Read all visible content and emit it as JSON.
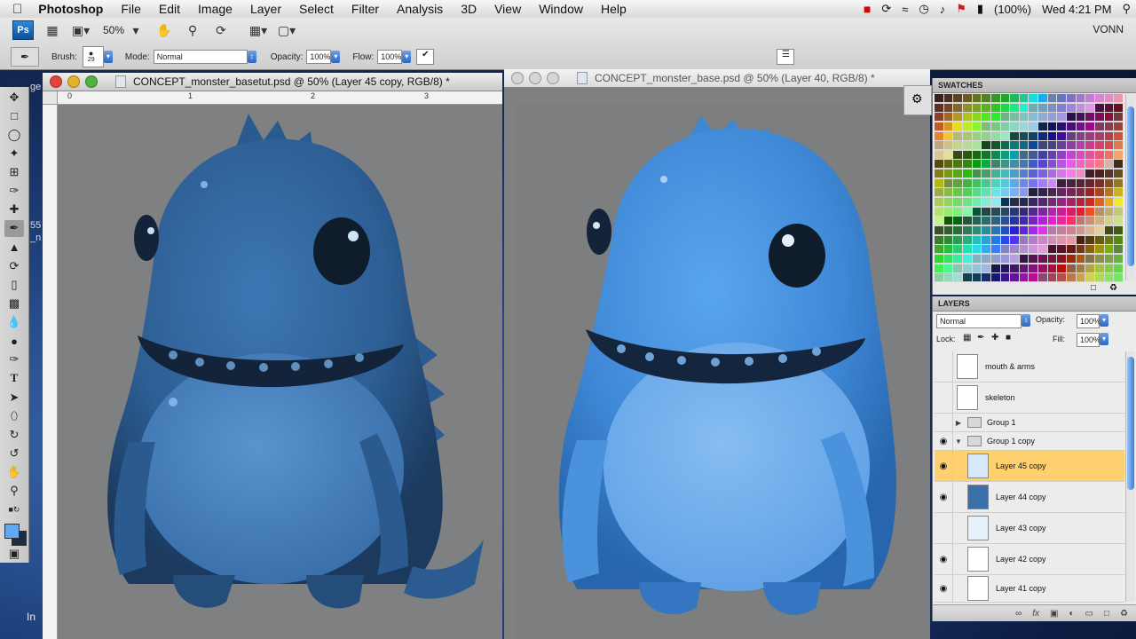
{
  "menubar": {
    "app_name": "Photoshop",
    "items": [
      "File",
      "Edit",
      "Image",
      "Layer",
      "Select",
      "Filter",
      "Analysis",
      "3D",
      "View",
      "Window",
      "Help"
    ],
    "battery": "(100%)",
    "clock": "Wed 4:21 PM"
  },
  "appbar": {
    "logo": "Ps",
    "zoom": "50%",
    "user": "VONN"
  },
  "tool_options": {
    "brush_label": "Brush:",
    "brush_size": "29",
    "mode_label": "Mode:",
    "mode_value": "Normal",
    "opacity_label": "Opacity:",
    "opacity_value": "100%",
    "flow_label": "Flow:",
    "flow_value": "100%"
  },
  "doc_left": {
    "title": "CONCEPT_monster_basetut.psd @ 50% (Layer 45 copy, RGB/8) *",
    "ruler_labels": [
      "0",
      "1",
      "2",
      "3"
    ]
  },
  "doc_right": {
    "title": "CONCEPT_monster_base.psd @ 50% (Layer 40, RGB/8) *"
  },
  "desktop_text": {
    "partial1": "ge",
    "partial2": "55",
    "partial3": "_n",
    "partial4": "In"
  },
  "swatches": {
    "title": "SWATCHES"
  },
  "layers": {
    "title": "LAYERS",
    "blend_mode": "Normal",
    "opacity_label": "Opacity:",
    "opacity_value": "100%",
    "lock_label": "Lock:",
    "fill_label": "Fill:",
    "fill_value": "100%",
    "rows": [
      {
        "name": "mouth & arms",
        "visible": false,
        "kind": "layer"
      },
      {
        "name": "skeleton",
        "visible": false,
        "kind": "layer"
      },
      {
        "name": "Group 1",
        "visible": false,
        "kind": "group",
        "expanded": false
      },
      {
        "name": "Group 1 copy",
        "visible": true,
        "kind": "group",
        "expanded": true
      },
      {
        "name": "Layer 45 copy",
        "visible": true,
        "kind": "layer",
        "selected": true
      },
      {
        "name": "Layer 44 copy",
        "visible": true,
        "kind": "layer"
      },
      {
        "name": "Layer 43 copy",
        "visible": false,
        "kind": "layer"
      },
      {
        "name": "Layer 42 copy",
        "visible": true,
        "kind": "layer"
      },
      {
        "name": "Layer 41 copy",
        "visible": true,
        "kind": "layer"
      }
    ]
  },
  "colors": {
    "monster_dark": "#2e5f93",
    "monster_light": "#4b93e0",
    "canvas_gray": "#808080",
    "selection": "#ffd070"
  }
}
